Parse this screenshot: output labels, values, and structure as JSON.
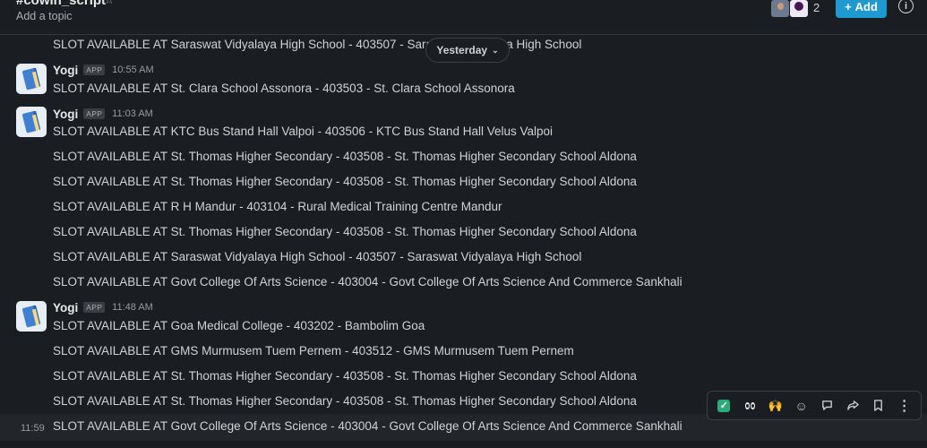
{
  "header": {
    "channel_name": "#cowin_script",
    "topic": "Add a topic",
    "member_count": "2",
    "add_label": "Add",
    "add_icon": "+",
    "info_icon": "i"
  },
  "date_divider": {
    "label": "Yesterday"
  },
  "top_partial_message": "SLOT AVAILABLE AT Saraswat Vidyalaya High School - 403507 - Saraswat Vidyalaya High School",
  "groups": [
    {
      "sender": "Yogi",
      "badge": "APP",
      "time": "10:55 AM",
      "messages": [
        "SLOT AVAILABLE AT St. Clara School Assonora - 403503 - St. Clara School Assonora"
      ]
    },
    {
      "sender": "Yogi",
      "badge": "APP",
      "time": "11:03 AM",
      "messages": [
        "SLOT AVAILABLE AT KTC Bus Stand Hall Valpoi - 403506 - KTC Bus Stand Hall Velus Valpoi",
        "SLOT AVAILABLE AT St. Thomas Higher Secondary - 403508 - St. Thomas Higher Secondary School Aldona",
        "SLOT AVAILABLE AT St. Thomas Higher Secondary - 403508 - St. Thomas Higher Secondary School Aldona",
        "SLOT AVAILABLE AT R H Mandur - 403104 - Rural Medical Training Centre Mandur",
        "SLOT AVAILABLE AT St. Thomas Higher Secondary - 403508 - St. Thomas Higher Secondary School Aldona",
        "SLOT AVAILABLE AT Saraswat Vidyalaya High School - 403507 - Saraswat Vidyalaya High School",
        "SLOT AVAILABLE AT Govt College Of Arts Science - 403004 - Govt College Of Arts Science And Commerce Sankhali"
      ]
    },
    {
      "sender": "Yogi",
      "badge": "APP",
      "time": "11:48 AM",
      "messages": [
        "SLOT AVAILABLE AT Goa Medical College - 403202 - Bambolim Goa",
        "SLOT AVAILABLE AT GMS Murmusem Tuem Pernem - 403512 - GMS Murmusem Tuem Pernem",
        "SLOT AVAILABLE AT St. Thomas Higher Secondary - 403508 - St. Thomas Higher Secondary School Aldona",
        "SLOT AVAILABLE AT St. Thomas Higher Secondary - 403508 - St. Thomas Higher Secondary School Aldona",
        "SLOT AVAILABLE AT Govt College Of Arts Science - 403004 - Govt College Of Arts Science And Commerce Sankhali"
      ]
    }
  ],
  "hover_time": "11:59",
  "toolbar_icons": [
    "check-mark-reaction",
    "eyes-reaction",
    "raised-hands-reaction",
    "add-reaction",
    "reply-in-thread",
    "share",
    "save",
    "more-actions"
  ]
}
